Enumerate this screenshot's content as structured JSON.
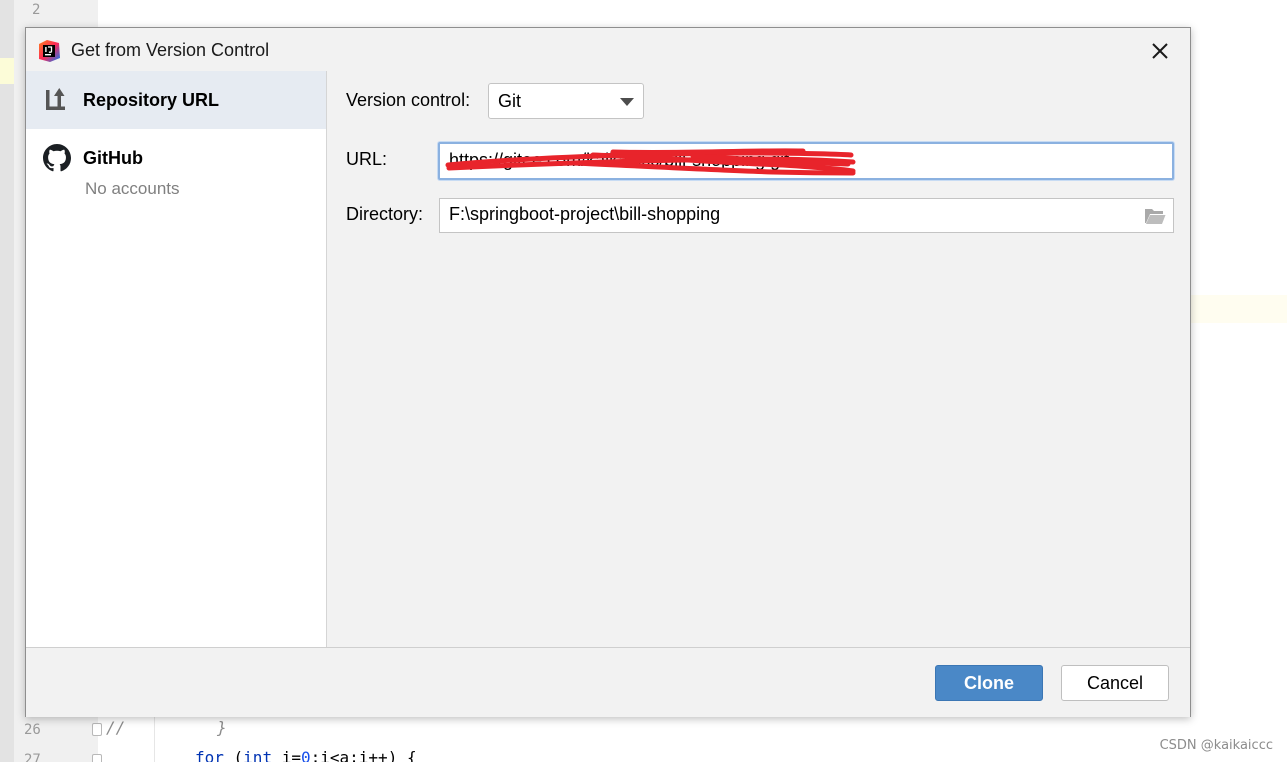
{
  "editor": {
    "line_numbers": [
      "2",
      "26",
      "27"
    ],
    "line26_comment": "//",
    "line26_code": "}",
    "line27_code": {
      "kw_for": "for",
      "p1": " (",
      "kw_int": "int",
      "p2": " i=",
      "num0": "0",
      "p3": ";i<a;i++) {"
    }
  },
  "dialog": {
    "title": "Get from Version Control",
    "app_icon": "intellij-idea-icon",
    "sidebar": {
      "items": [
        {
          "label": "Repository URL",
          "icon": "vcs-upload-icon",
          "selected": true
        },
        {
          "label": "GitHub",
          "sublabel": "No accounts",
          "icon": "github-icon",
          "selected": false
        }
      ]
    },
    "version_control": {
      "label": "Version control:",
      "value": "Git"
    },
    "url": {
      "label": "URL:",
      "value": "https://gitee.com/kaikaiccc/bill-shopping.git"
    },
    "directory": {
      "label": "Directory:",
      "value": "F:\\springboot-project\\bill-shopping"
    },
    "buttons": {
      "clone": "Clone",
      "cancel": "Cancel"
    }
  },
  "watermark": "CSDN @kaikaiccc",
  "colors": {
    "accent": "#4a88c7",
    "selection": "#e6ebf2",
    "redaction": "#e8242b"
  }
}
